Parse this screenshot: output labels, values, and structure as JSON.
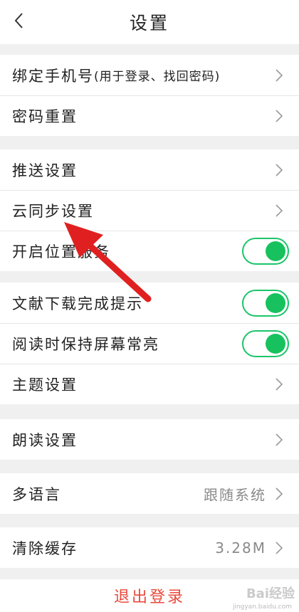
{
  "header": {
    "title": "设置",
    "back_icon": "chevron-left-icon"
  },
  "groups": [
    {
      "items": [
        {
          "label": "绑定手机号",
          "sublabel": "(用于登录、找回密码)",
          "control": "chevron"
        },
        {
          "label": "密码重置",
          "control": "chevron"
        }
      ]
    },
    {
      "items": [
        {
          "label": "推送设置",
          "control": "chevron"
        },
        {
          "label": "云同步设置",
          "control": "chevron"
        },
        {
          "label": "开启位置服务",
          "control": "toggle",
          "on": true
        }
      ]
    },
    {
      "items": [
        {
          "label": "文献下载完成提示",
          "control": "toggle",
          "on": true
        },
        {
          "label": "阅读时保持屏幕常亮",
          "control": "toggle",
          "on": true
        },
        {
          "label": "主题设置",
          "control": "chevron"
        }
      ]
    },
    {
      "items": [
        {
          "label": "朗读设置",
          "control": "chevron"
        }
      ]
    },
    {
      "items": [
        {
          "label": "多语言",
          "value": "跟随系统",
          "control": "chevron"
        }
      ]
    },
    {
      "items": [
        {
          "label": "清除缓存",
          "value": "3.28M",
          "control": "chevron"
        }
      ]
    }
  ],
  "logout": {
    "label": "退出登录"
  },
  "colors": {
    "toggle_on": "#17c25e",
    "logout_text": "#e84a3c",
    "annotation_arrow": "#e02020"
  },
  "watermark": {
    "text": "Bai经验",
    "sub": "jingyan.baidu.com"
  }
}
